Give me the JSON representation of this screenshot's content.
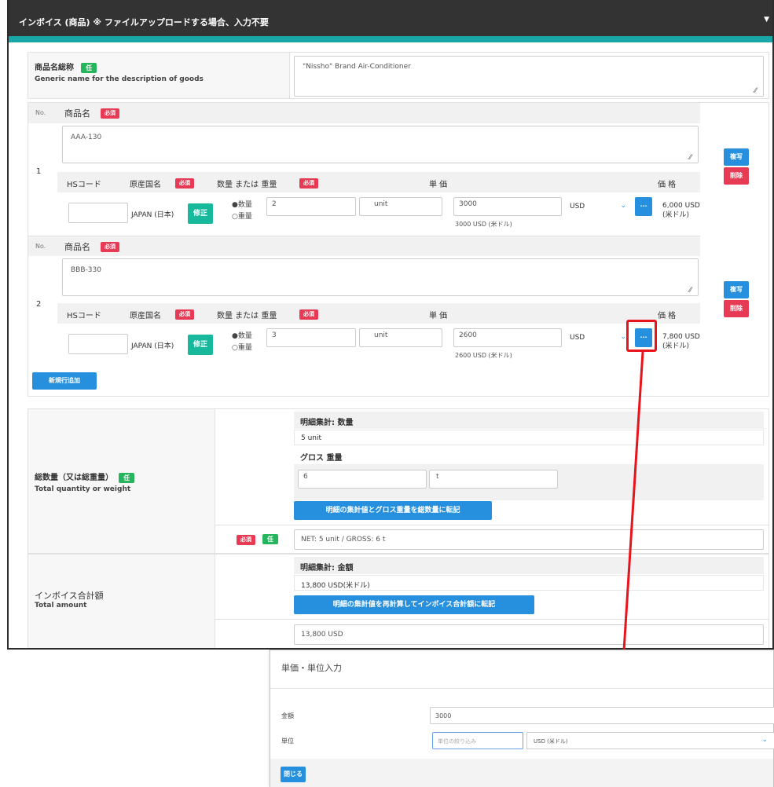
{
  "panel": {
    "title": "インボイス (商品) ※ ファイルアップロードする場合、入力不要",
    "collapse_caret": "▼"
  },
  "generic": {
    "label_ja": "商品名総称",
    "badge": "任",
    "label_en": "Generic name for the description of goods",
    "value": "\"Nissho\" Brand Air-Conditioner"
  },
  "headers": {
    "no": "No.",
    "product_name": "商品名",
    "required": "必須",
    "hs_code": "HSコード",
    "origin": "原産国名",
    "qty_weight": "数量 または 重量",
    "unit_price": "単 価",
    "price": "価 格"
  },
  "items": [
    {
      "no": "1",
      "name": "AAA-130",
      "hs_code": "",
      "origin": "JAPAN (日本)",
      "fix_label": "修正",
      "radio_qty": "●数量",
      "radio_weight": "○重量",
      "qty": "2",
      "qty_unit": "unit",
      "unit_price": "3000",
      "currency": "USD",
      "unit_price_note": "3000 USD (米ドル)",
      "price": "6,000 USD",
      "price_sub": "(米ドル)",
      "copy_label": "複写",
      "delete_label": "削除",
      "dots_label": "..."
    },
    {
      "no": "2",
      "name": "BBB-330",
      "hs_code": "",
      "origin": "JAPAN (日本)",
      "fix_label": "修正",
      "radio_qty": "●数量",
      "radio_weight": "○重量",
      "qty": "3",
      "qty_unit": "unit",
      "unit_price": "2600",
      "currency": "USD",
      "unit_price_note": "2600 USD (米ドル)",
      "price": "7,800 USD",
      "price_sub": "(米ドル)",
      "copy_label": "複写",
      "delete_label": "削除",
      "dots_label": "..."
    }
  ],
  "add_row_label": "新規行追加",
  "total_qty": {
    "label_ja": "総数量（又は総重量）",
    "badge": "任",
    "label_en": "Total quantity or weight",
    "detail_qty_label": "明細集計: 数量",
    "detail_qty_value": "5 unit",
    "gross_label": "グロス 重量",
    "gross_value": "6",
    "gross_unit": "t",
    "transfer_btn": "明細の集計値とグロス重量を総数量に転記",
    "req_badge": "必須",
    "opt_badge": "任",
    "summary": "NET: 5 unit / GROSS: 6 t"
  },
  "total_amount": {
    "label_ja": "インボイス合計額",
    "label_en": "Total amount",
    "detail_label": "明細集計: 金額",
    "detail_value": "13,800 USD(米ドル)",
    "recalc_btn": "明細の集計値を再計算してインボイス合計額に転記",
    "value": "13,800 USD"
  },
  "modal": {
    "title": "単価・単位入力",
    "amount_label": "金額",
    "amount_value": "3000",
    "unit_label": "単位",
    "unit_placeholder": "単位の絞り込み",
    "unit_select": "USD (米ドル)",
    "close_label": "閉じる"
  },
  "colors": {
    "header_bg": "#333333",
    "accent_teal": "#1aa6a6",
    "button_blue": "#2790de",
    "badge_red": "#e63a55",
    "badge_green": "#26b55c",
    "highlight_red": "#e8141b"
  }
}
